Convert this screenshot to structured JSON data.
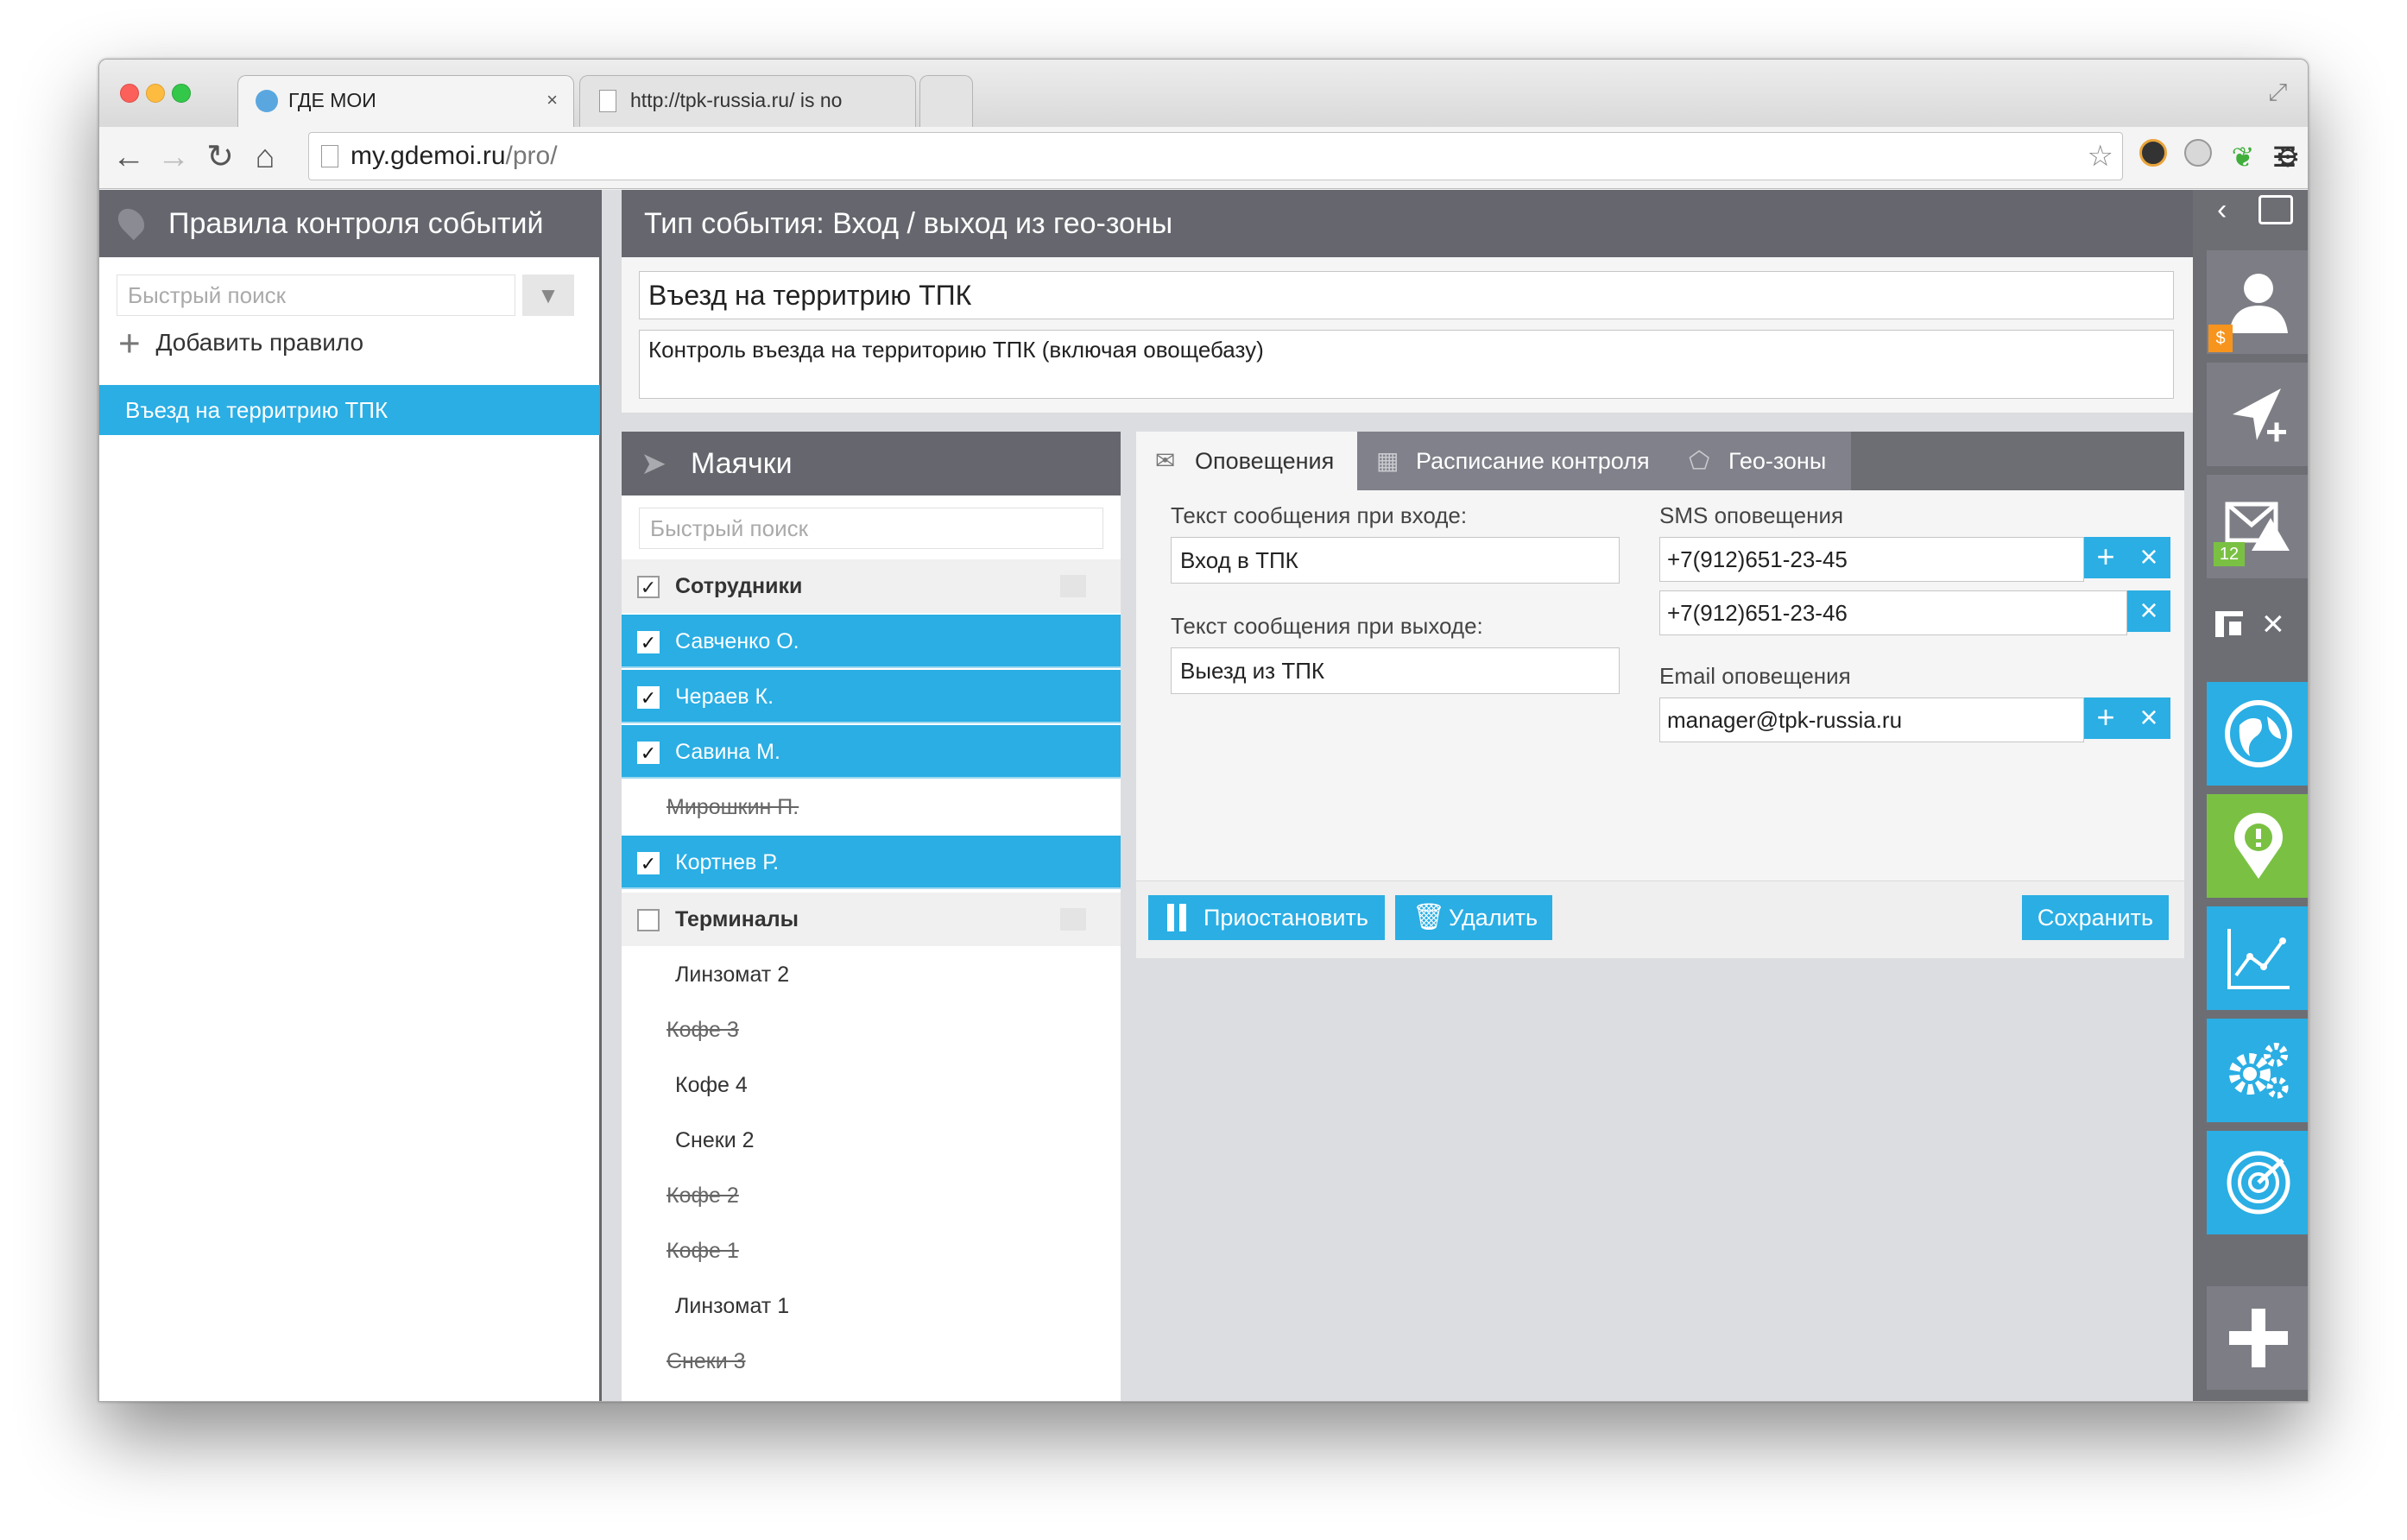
{
  "browser": {
    "tabs": [
      {
        "title": "ГДЕ МОИ",
        "close": "×"
      },
      {
        "title": "http://tpk-russia.ru/ is no",
        "close": "×"
      }
    ],
    "url_host": "my.gdemoi.ru",
    "url_path": "/pro/"
  },
  "left_panel": {
    "title": "Правила контроля событий",
    "search_placeholder": "Быстрый поиск",
    "add_rule_label": "Добавить правило",
    "rules": [
      "Въезд на территрию ТПК"
    ]
  },
  "event": {
    "type_title": "Тип события: Вход / выход из гео-зоны",
    "name_value": "Въезд на территрию ТПК",
    "description_value": "Контроль въезда на территорию ТПК (включая овощебазу)"
  },
  "beacons": {
    "title": "Маячки",
    "search_placeholder": "Быстрый поиск",
    "groups": [
      {
        "label": "Сотрудники",
        "checked": true,
        "items": [
          {
            "label": "Савченко О.",
            "checked": true,
            "disabled": false
          },
          {
            "label": "Чераев К.",
            "checked": true,
            "disabled": false
          },
          {
            "label": "Савина М.",
            "checked": true,
            "disabled": false
          },
          {
            "label": "Мирошкин П.",
            "checked": false,
            "disabled": true
          },
          {
            "label": "Кортнев Р.",
            "checked": true,
            "disabled": false
          }
        ]
      },
      {
        "label": "Терминалы",
        "checked": false,
        "items": [
          {
            "label": "Линзомат 2",
            "disabled": false
          },
          {
            "label": "Кофе 3",
            "disabled": true
          },
          {
            "label": "Кофе 4",
            "disabled": false
          },
          {
            "label": "Снеки 2",
            "disabled": false
          },
          {
            "label": "Кофе 2",
            "disabled": true
          },
          {
            "label": "Кофе 1",
            "disabled": true
          },
          {
            "label": "Линзомат 1",
            "disabled": false
          },
          {
            "label": "Снеки 3",
            "disabled": true
          }
        ]
      }
    ]
  },
  "tabs": [
    {
      "label": "Оповещения",
      "active": true
    },
    {
      "label": "Расписание контроля",
      "active": false
    },
    {
      "label": "Гео-зоны",
      "active": false
    }
  ],
  "notifications": {
    "enter_label": "Текст сообщения при входе:",
    "enter_value": "Вход в ТПК",
    "exit_label": "Текст сообщения при выходе:",
    "exit_value": "Выезд из ТПК",
    "sms_label": "SMS оповещения",
    "sms_numbers": [
      "+7(912)651-23-45",
      "+7(912)651-23-46"
    ],
    "email_label": "Email оповещения",
    "email_value": "manager@tpk-russia.ru"
  },
  "actions": {
    "pause": "Приостановить",
    "delete": "Удалить",
    "save": "Сохранить"
  },
  "sidebar": {
    "balance_badge": "$",
    "messages_count": "12"
  },
  "colors": {
    "accent": "#2aaee4",
    "panel_header": "#66676e",
    "green": "#7ac143",
    "orange": "#f7941d"
  }
}
